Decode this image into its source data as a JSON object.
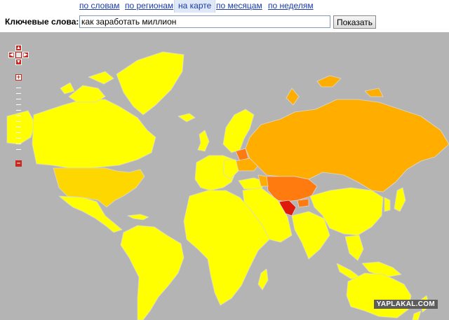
{
  "tabs": [
    {
      "label": "по словам",
      "active": false
    },
    {
      "label": "по регионам",
      "active": false
    },
    {
      "label": "на карте",
      "active": true
    },
    {
      "label": "по месяцам",
      "active": false
    },
    {
      "label": "по неделям",
      "active": false
    }
  ],
  "search": {
    "label": "Ключевые слова:",
    "value": "как заработать миллион",
    "button": "Показать"
  },
  "map_controls": {
    "zoom_in": "+",
    "zoom_out": "−",
    "pan": [
      "up",
      "down",
      "left",
      "right",
      "center"
    ]
  },
  "legend_colors": {
    "ocean": "#b4b4b4",
    "low": "#ffff00",
    "medium": "#ffd700",
    "high": "#ffae00",
    "very_high": "#ff7b10",
    "top": "#e01a0a",
    "borders": "#d8d8d8"
  },
  "watermark": "YAPLAKAL.COM"
}
